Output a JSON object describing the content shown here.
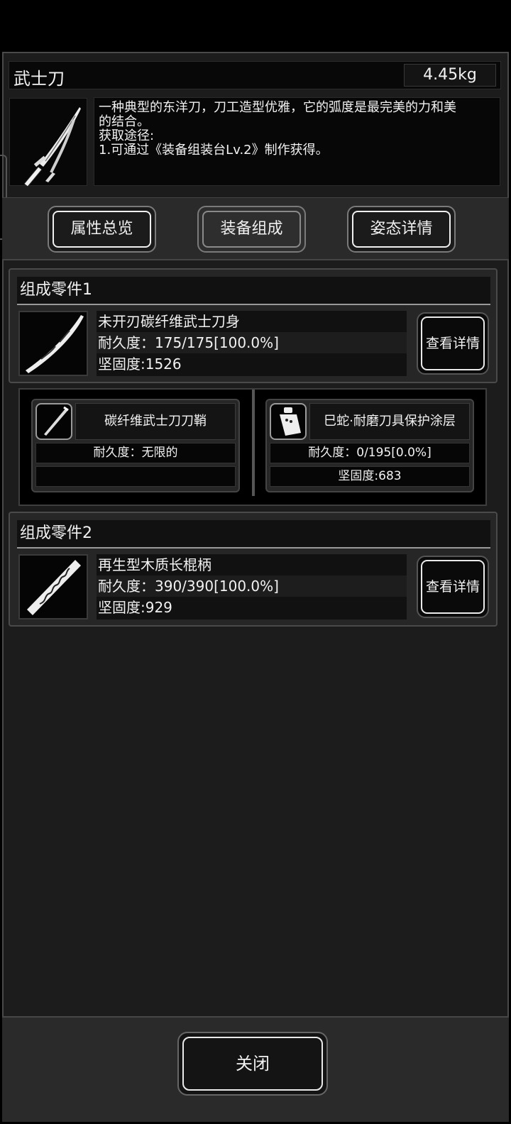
{
  "item": {
    "name": "武士刀",
    "weight": "4.45kg",
    "description_lines": [
      "一种典型的东洋刀，刀工造型优雅，它的弧度是最完美的力和美",
      "的结合。",
      "获取途径:",
      "1.可通过《装备组装台Lv.2》制作获得。"
    ]
  },
  "tabs": [
    {
      "label": "属性总览",
      "active": false
    },
    {
      "label": "装备组成",
      "active": true
    },
    {
      "label": "姿态详情",
      "active": false
    }
  ],
  "parts": [
    {
      "section_title": "组成零件1",
      "name": "未开刃碳纤维武士刀身",
      "durability": "耐久度：175/175[100.0%]",
      "hardness": "坚固度:1526",
      "detail_label": "查看详情",
      "icon": "blade-icon"
    },
    {
      "section_title": "组成零件2",
      "name": "再生型木质长棍柄",
      "durability": "耐久度：390/390[100.0%]",
      "hardness": "坚固度:929",
      "detail_label": "查看详情",
      "icon": "wooden-handle-icon"
    }
  ],
  "subparts": [
    {
      "name": "碳纤维武士刀刀鞘",
      "durability": "耐久度：无限的",
      "hardness": "",
      "icon": "scabbard-icon"
    },
    {
      "name": "巳蛇·耐磨刀具保护涂层",
      "durability": "耐久度：0/195[0.0%]",
      "hardness": "坚固度:683",
      "icon": "coating-bottle-icon"
    }
  ],
  "footer": {
    "close_label": "关闭"
  },
  "colors": {
    "panel_bg": "#1c1c1c",
    "border": "#4a4a4a",
    "text": "#f2f2f2"
  }
}
